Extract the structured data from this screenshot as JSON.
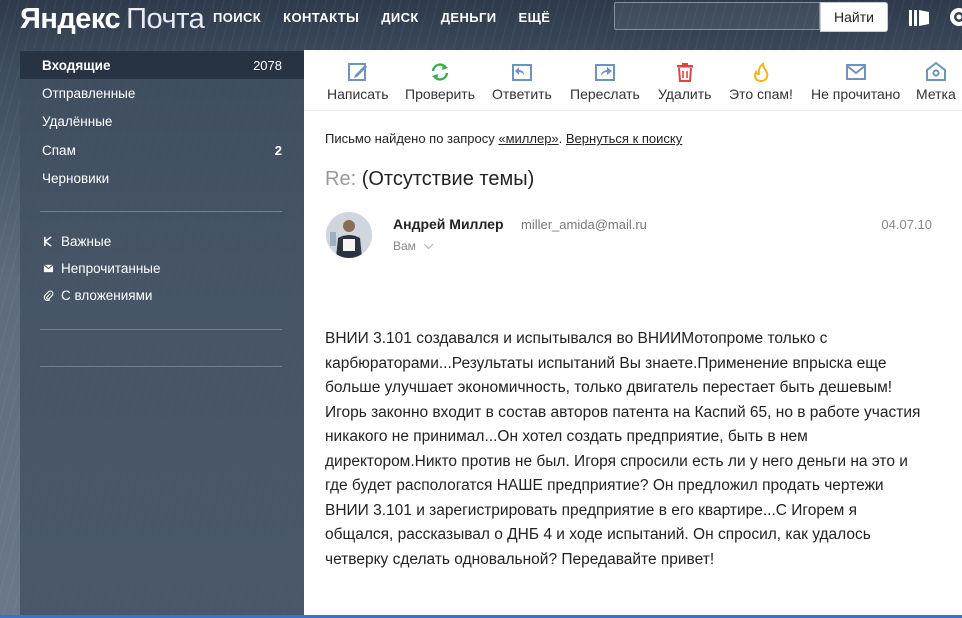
{
  "header": {
    "logo_brand": "Яндекс",
    "logo_product": "Почта",
    "nav": [
      "ПОИСК",
      "КОНТАКТЫ",
      "ДИСК",
      "ДЕНЬГИ",
      "ЕЩЁ"
    ],
    "search": {
      "value": "",
      "button": "Найти"
    }
  },
  "sidebar": {
    "folders": [
      {
        "label": "Входящие",
        "count": "2078"
      },
      {
        "label": "Отправленные",
        "count": ""
      },
      {
        "label": "Удалённые",
        "count": ""
      },
      {
        "label": "Спам",
        "count": "2"
      },
      {
        "label": "Черновики",
        "count": ""
      }
    ],
    "labels": [
      {
        "label": "Важные",
        "icon": "important-icon"
      },
      {
        "label": "Непрочитанные",
        "icon": "unread-icon"
      },
      {
        "label": "С вложениями",
        "icon": "attachment-icon"
      }
    ]
  },
  "toolbar": {
    "compose": "Написать",
    "check": "Проверить",
    "reply": "Ответить",
    "forward": "Переслать",
    "delete": "Удалить",
    "spam": "Это спам!",
    "unread": "Не прочитано",
    "label": "Метка"
  },
  "message": {
    "notice_prefix": "Письмо найдено по запросу ",
    "notice_query": "«миллер»",
    "notice_sep": ". ",
    "notice_back": "Вернуться к поиску",
    "subject_prefix": "Re:",
    "subject": "(Отсутствие темы)",
    "sender_name": "Андрей Миллер",
    "sender_email": "miller_amida@mail.ru",
    "to": "Вам",
    "date": "04.07.10",
    "body": "ВНИИ 3.101 создавался и испытывался во ВНИИМотопроме только с карбюраторами...Результаты испытаний Вы знаете.Применение впрыска еще больше улучшает экономичность, только двигатель перестает быть дешевым! Игорь законно входит в состав авторов патента на Каспий 65, но в работе участия никакого не принимал...Он хотел создать предприятие, быть в нем директором.Никто против не был. Игоря спросили есть ли у него деньги на это и где будет распологатся НАШЕ предприятие? Он предложил продать чертежи ВНИИ 3.101 и зарегистрировать предприятие в его квартире...С Игорем я общался, рассказывал о ДНБ 4 и ходе испытаний. Он спросил, как удалось четверку сделать одновальной? Передавайте привет!"
  },
  "colors": {
    "accent": "#3b73c4",
    "toolbar_icon": "#6f93bd",
    "check_icon": "#3daa4c",
    "delete_icon": "#e0463b",
    "spam_icon": "#f3b41b"
  }
}
